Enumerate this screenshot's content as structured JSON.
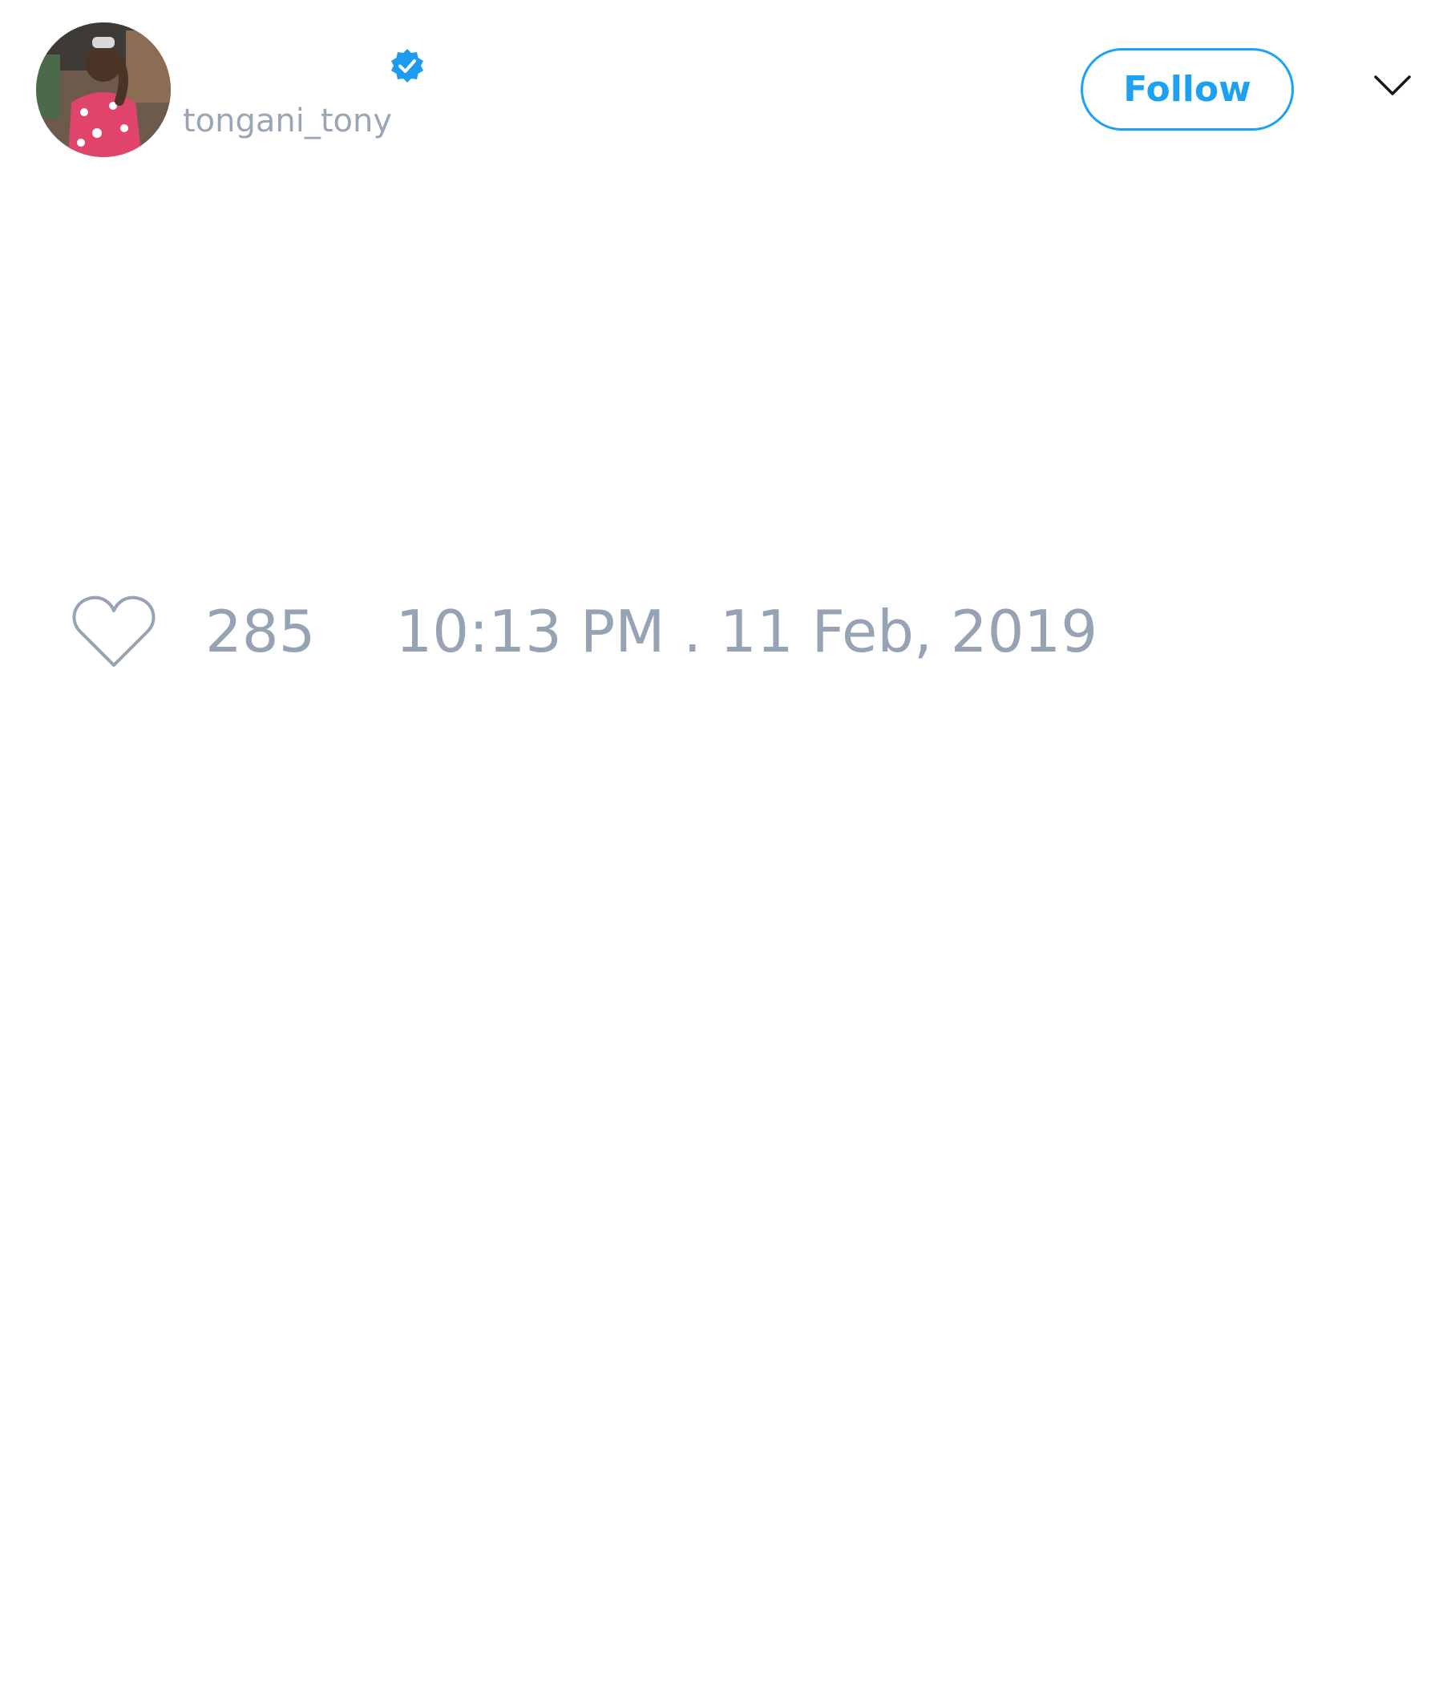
{
  "tweet": {
    "author": {
      "handle": "tongani_tony",
      "avatar_icon": "profile-photo",
      "verified_icon": "verified-badge-icon"
    },
    "actions": {
      "follow_label": "Follow",
      "menu_icon": "chevron-down-icon"
    },
    "footer": {
      "like_icon": "heart-icon",
      "like_count": "285",
      "timestamp": "10:13 PM . 11 Feb, 2019"
    }
  },
  "colors": {
    "accent": "#1da1f2",
    "muted_text": "#95a3b5",
    "background": "#ffffff"
  }
}
